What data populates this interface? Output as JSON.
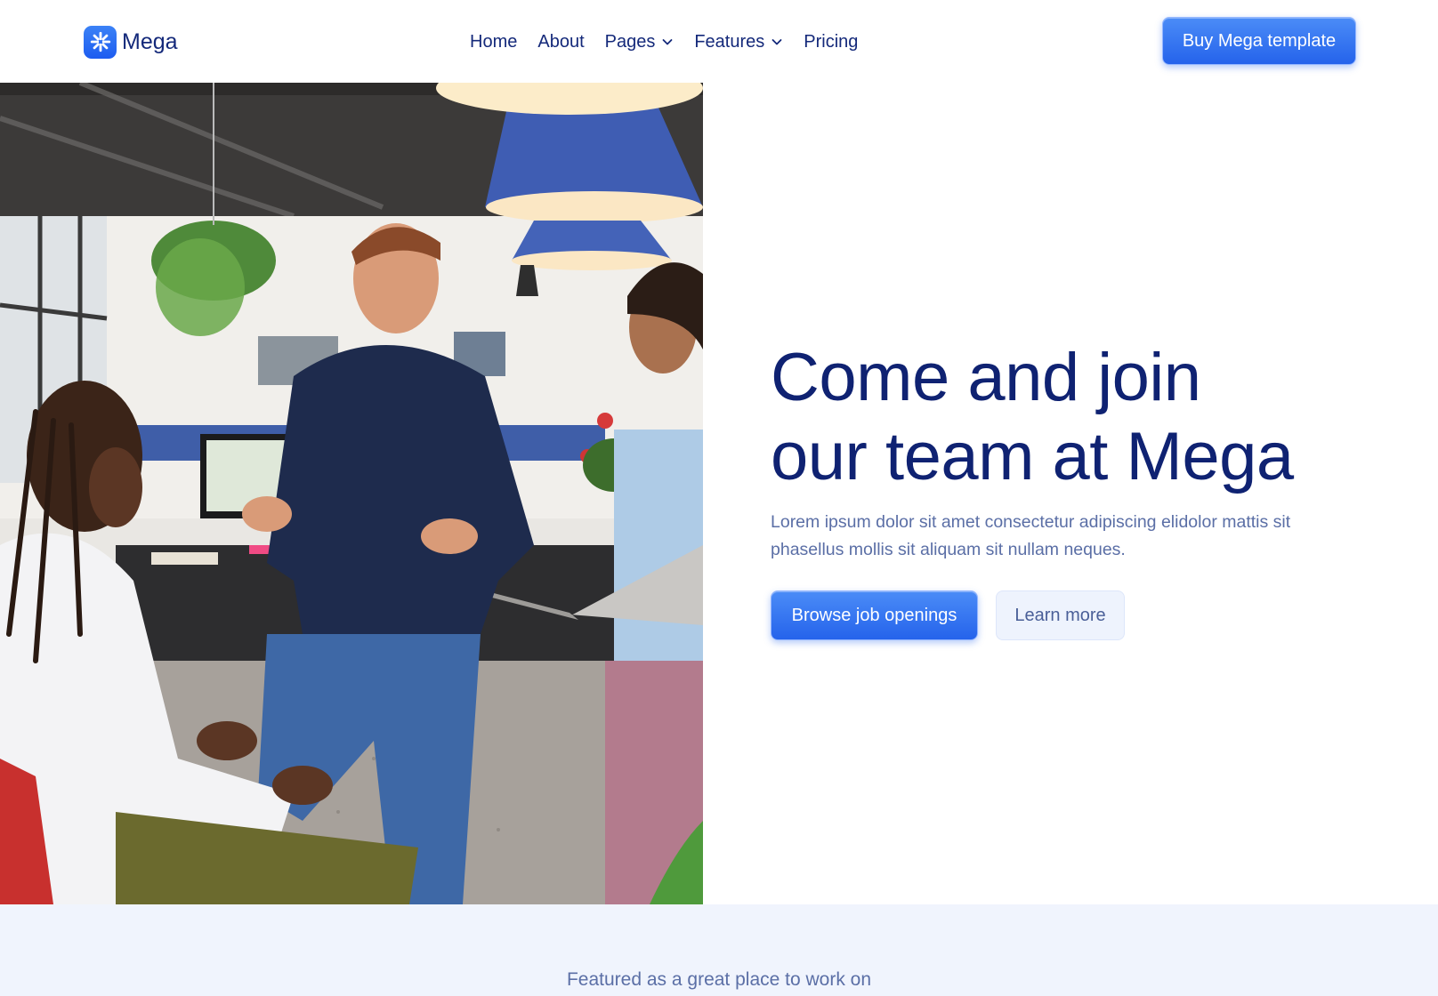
{
  "brand": {
    "name": "Mega",
    "logo_icon": "asterisk-icon",
    "accent": "#2563eb"
  },
  "nav": {
    "items": [
      {
        "label": "Home",
        "has_dropdown": false
      },
      {
        "label": "About",
        "has_dropdown": false
      },
      {
        "label": "Pages",
        "has_dropdown": true
      },
      {
        "label": "Features",
        "has_dropdown": true
      },
      {
        "label": "Pricing",
        "has_dropdown": false
      }
    ],
    "cta_label": "Buy Mega template"
  },
  "hero": {
    "title_line1": "Come and join",
    "title_line2": "our team at Mega",
    "subtitle": "Lorem ipsum dolor sit amet consectetur adipiscing elidolor mattis sit phasellus mollis sit aliquam sit nullam neques.",
    "primary_cta": "Browse job openings",
    "secondary_cta": "Learn more",
    "image_alt": "Team of three colleagues talking in an office"
  },
  "featured": {
    "text": "Featured as a great place to work on"
  },
  "colors": {
    "heading": "#0f2272",
    "body": "#5b6fa6",
    "button_gradient_top": "#4b8cf7",
    "button_gradient_bottom": "#2563eb",
    "secondary_bg": "#eef3fd",
    "featured_bg": "#f0f4fd"
  }
}
